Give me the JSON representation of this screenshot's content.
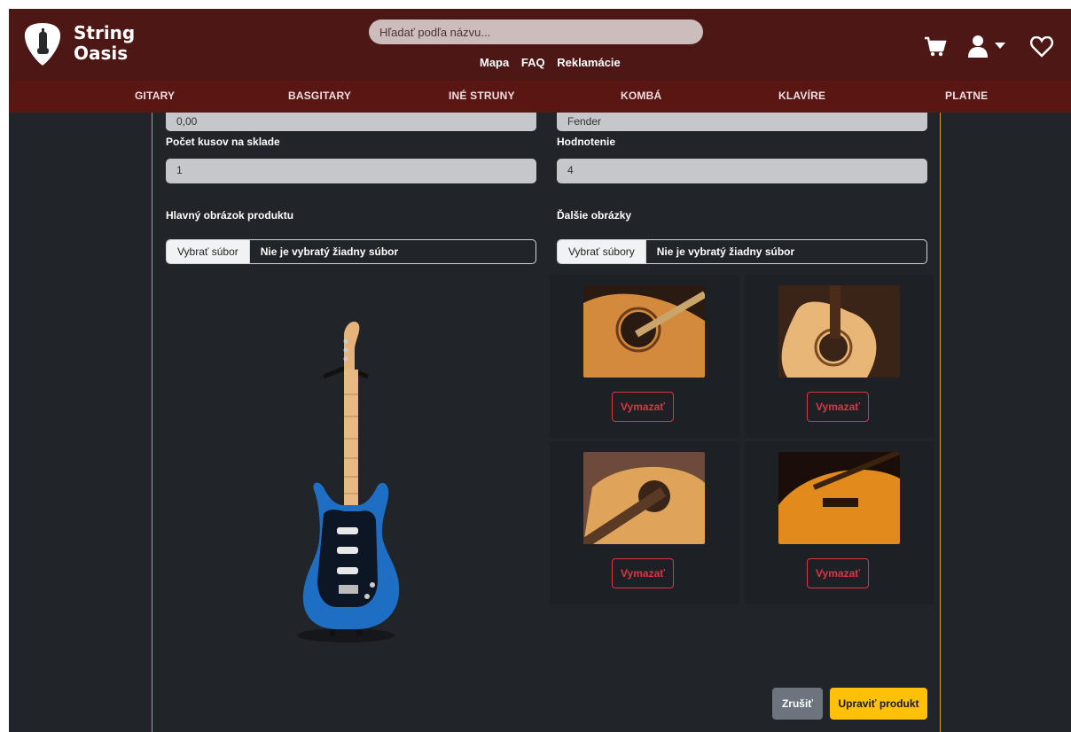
{
  "brand": {
    "line1": "String",
    "line2": "Oasis"
  },
  "search": {
    "placeholder": "Hľadať podľa názvu..."
  },
  "top_links": [
    "Mapa",
    "FAQ",
    "Reklamácie"
  ],
  "categories": [
    "GITARY",
    "BASGITARY",
    "INÉ STRUNY",
    "KOMBÁ",
    "KLAVÍRE",
    "PLATNE"
  ],
  "form": {
    "price_value": "0,00",
    "brand_value": "Fender",
    "stock_label": "Počet kusov na sklade",
    "stock_value": "1",
    "rating_label": "Hodnotenie",
    "rating_value": "4",
    "main_image_label": "Hlavný obrázok produktu",
    "main_file_button": "Vybrať súbor",
    "main_file_status": "Nie je vybratý žiadny súbor",
    "extra_images_label": "Ďalšie obrázky",
    "extra_file_button": "Vybrať súbory",
    "extra_file_status": "Nie je vybratý žiadny súbor",
    "delete_label": "Vymazať",
    "cancel_label": "Zrušiť",
    "submit_label": "Upraviť produkt"
  },
  "icons": [
    "guitar-pick-logo-icon",
    "cart-icon",
    "user-icon",
    "caret-down-icon",
    "heart-icon"
  ],
  "colors": {
    "header": "#4c1714",
    "nav": "#5a1612",
    "background": "#212429",
    "accent": "#ffc107",
    "danger": "#dc3545",
    "panel_border": "#c9a227"
  }
}
